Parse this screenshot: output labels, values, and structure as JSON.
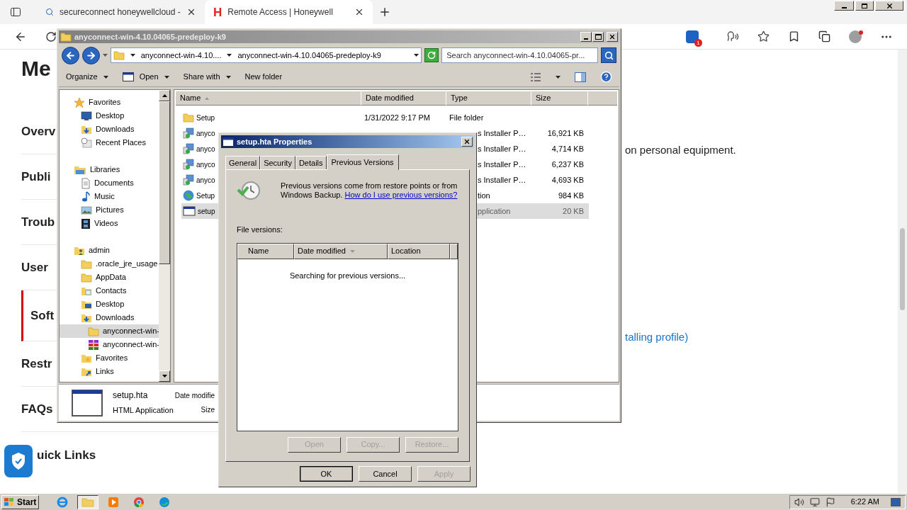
{
  "browser": {
    "tabs": [
      {
        "title": "secureconnect honeywellcloud -",
        "selected": false,
        "kind": "search"
      },
      {
        "title": "Remote Access | Honeywell",
        "selected": true,
        "kind": "site",
        "logo": "H"
      }
    ],
    "extension_badge": "1"
  },
  "page": {
    "heading": "Me",
    "nav": [
      {
        "label": "Overv",
        "selected": false
      },
      {
        "label": "Publi",
        "selected": false
      },
      {
        "label": "Troub",
        "selected": false
      },
      {
        "label": "User",
        "selected": false
      },
      {
        "label": "Soft",
        "selected": true
      },
      {
        "label": "Restr",
        "selected": false
      },
      {
        "label": "FAQs",
        "selected": false
      }
    ],
    "quick_links": "uick Links",
    "text": "on personal equipment.",
    "link": "talling profile)"
  },
  "explorer": {
    "title": "anyconnect-win-4.10.04065-predeploy-k9",
    "breadcrumbs": [
      "anyconnect-win-4.10....",
      "anyconnect-win-4.10.04065-predeploy-k9"
    ],
    "search_placeholder": "Search anyconnect-win-4.10.04065-pr...",
    "toolbar": [
      {
        "label": "Organize",
        "kind": "plain",
        "menu": true
      },
      {
        "label": "Open",
        "kind": "window",
        "menu": true
      },
      {
        "label": "Share with",
        "kind": "plain",
        "menu": true
      },
      {
        "label": "New folder",
        "kind": "plain",
        "menu": false
      }
    ],
    "tree": [
      {
        "label": "Favorites",
        "kind": "star",
        "selected": false,
        "children": [
          {
            "label": "Desktop",
            "kind": "desktop",
            "selected": false
          },
          {
            "label": "Downloads",
            "kind": "download",
            "selected": false
          },
          {
            "label": "Recent Places",
            "kind": "recent",
            "selected": false
          }
        ]
      },
      {
        "label": "Libraries",
        "kind": "library",
        "selected": false,
        "children": [
          {
            "label": "Documents",
            "kind": "document",
            "selected": false
          },
          {
            "label": "Music",
            "kind": "music",
            "selected": false
          },
          {
            "label": "Pictures",
            "kind": "picture",
            "selected": false
          },
          {
            "label": "Videos",
            "kind": "video",
            "selected": false
          }
        ]
      },
      {
        "label": "admin",
        "kind": "user",
        "selected": false,
        "children": [
          {
            "label": ".oracle_jre_usage",
            "kind": "folder",
            "selected": false
          },
          {
            "label": "AppData",
            "kind": "folder",
            "selected": false
          },
          {
            "label": "Contacts",
            "kind": "contacts",
            "selected": false
          },
          {
            "label": "Desktop",
            "kind": "desktop-folder",
            "selected": false
          },
          {
            "label": "Downloads",
            "kind": "download",
            "selected": false,
            "children": [
              {
                "label": "anyconnect-win-",
                "kind": "folder",
                "selected": true
              },
              {
                "label": "anyconnect-win-",
                "kind": "archive",
                "selected": false
              }
            ]
          },
          {
            "label": "Favorites",
            "kind": "favorites",
            "selected": false
          },
          {
            "label": "Links",
            "kind": "links",
            "selected": false
          }
        ]
      }
    ],
    "columns": [
      {
        "label": "Name",
        "kind": "ascending"
      },
      {
        "label": "Date modified",
        "kind": "plain"
      },
      {
        "label": "Type",
        "kind": "plain"
      },
      {
        "label": "Size",
        "kind": "plain"
      }
    ],
    "files": [
      {
        "name": "Setup",
        "kind": "folder",
        "date": "1/31/2022 9:17 PM",
        "type": "File folder",
        "selected": false
      },
      {
        "name": "anyco",
        "kind": "installer",
        "type": "s Installer P…",
        "size": "16,921 KB",
        "selected": false
      },
      {
        "name": "anyco",
        "kind": "installer",
        "type": "s Installer P…",
        "size": "4,714 KB",
        "selected": false
      },
      {
        "name": "anyco",
        "kind": "installer",
        "type": "s Installer P…",
        "size": "6,237 KB",
        "selected": false
      },
      {
        "name": "anyco",
        "kind": "installer",
        "type": "s Installer P…",
        "size": "4,693 KB",
        "selected": false
      },
      {
        "name": "Setup",
        "kind": "globe",
        "type": "tion",
        "size": "984 KB",
        "selected": false
      },
      {
        "name": "setup",
        "kind": "hta",
        "type": "pplication",
        "size": "20 KB",
        "selected": true
      }
    ],
    "details": {
      "name": "setup.hta",
      "type": "HTML Application",
      "date_label": "Date modifie",
      "size_label": "Size"
    }
  },
  "dialog": {
    "title": "setup.hta Properties",
    "tabs": [
      {
        "label": "General",
        "selected": false
      },
      {
        "label": "Security",
        "selected": false
      },
      {
        "label": "Details",
        "selected": false
      },
      {
        "label": "Previous Versions",
        "selected": true
      }
    ],
    "info": "Previous versions come from restore points or from Windows Backup.",
    "help_link": "How do I use previous versions?",
    "list_label": "File versions:",
    "columns": [
      {
        "label": "Name",
        "kind": "plain"
      },
      {
        "label": "Date modified",
        "kind": "descending"
      },
      {
        "label": "Location",
        "kind": "plain"
      }
    ],
    "status": "Searching for previous versions...",
    "actions": [
      {
        "label": "Open",
        "disabled": true
      },
      {
        "label": "Copy...",
        "disabled": true
      },
      {
        "label": "Restore...",
        "disabled": true
      }
    ],
    "buttons": [
      {
        "label": "OK",
        "disabled": false,
        "default": true
      },
      {
        "label": "Cancel",
        "disabled": false,
        "default": false
      },
      {
        "label": "Apply",
        "disabled": true,
        "default": false
      }
    ]
  },
  "taskbar": {
    "start": "Start",
    "apps": [
      {
        "kind": "ie",
        "active": false
      },
      {
        "kind": "explorer",
        "active": true
      },
      {
        "kind": "media",
        "active": false
      },
      {
        "kind": "chrome",
        "active": false
      },
      {
        "kind": "edge",
        "active": false
      }
    ],
    "clock": "6:22 AM"
  }
}
